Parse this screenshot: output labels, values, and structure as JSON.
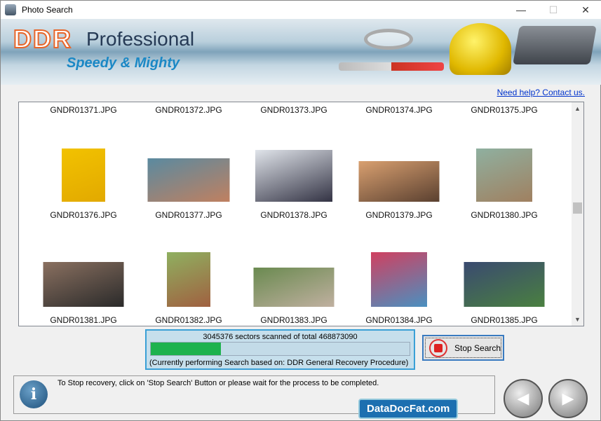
{
  "window": {
    "title": "Photo Search",
    "minimize": "—",
    "maximize": "☐",
    "close": "✕"
  },
  "banner": {
    "brand": "DDR",
    "product": "Professional",
    "tagline": "Speedy & Mighty"
  },
  "help_link": "Need help? Contact us.",
  "files": [
    "GNDR01371.JPG",
    "GNDR01372.JPG",
    "GNDR01373.JPG",
    "GNDR01374.JPG",
    "GNDR01375.JPG",
    "GNDR01376.JPG",
    "GNDR01377.JPG",
    "GNDR01378.JPG",
    "GNDR01379.JPG",
    "GNDR01380.JPG",
    "GNDR01381.JPG",
    "GNDR01382.JPG",
    "GNDR01383.JPG",
    "GNDR01384.JPG",
    "GNDR01385.JPG"
  ],
  "progress": {
    "text": "3045376 sectors scanned of total 468873090",
    "percent": 27,
    "procedure": "(Currently performing Search based on:  DDR General Recovery Procedure)",
    "color": "#1db24e"
  },
  "stop_button": "Stop Search",
  "status": {
    "message": "To Stop recovery, click on 'Stop Search' Button or please wait for the process to be completed."
  },
  "footer_logo": "DataDocFat.com"
}
